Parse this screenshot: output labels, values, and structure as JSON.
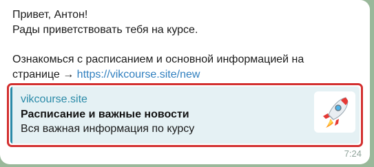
{
  "message": {
    "line1": "Привет, Антон!",
    "line2": "Рады приветствовать тебя на курсе.",
    "line3": "Ознакомься с расписанием и основной информацией на",
    "line4_prefix": "странице → ",
    "link_text": "https://vikcourse.site/new"
  },
  "link_preview": {
    "site_name": "vikcourse.site",
    "title": "Расписание и важные новости",
    "description": "Вся важная информация по курсу",
    "thumbnail_icon": "rocket-icon"
  },
  "timestamp": "7:24",
  "colors": {
    "background": "#9ab89a",
    "bubble": "#ffffff",
    "link": "#2f7fbf",
    "preview_background": "#e5f1f4",
    "preview_accent": "#2a8aa8",
    "highlight_border": "#d32f2f"
  }
}
